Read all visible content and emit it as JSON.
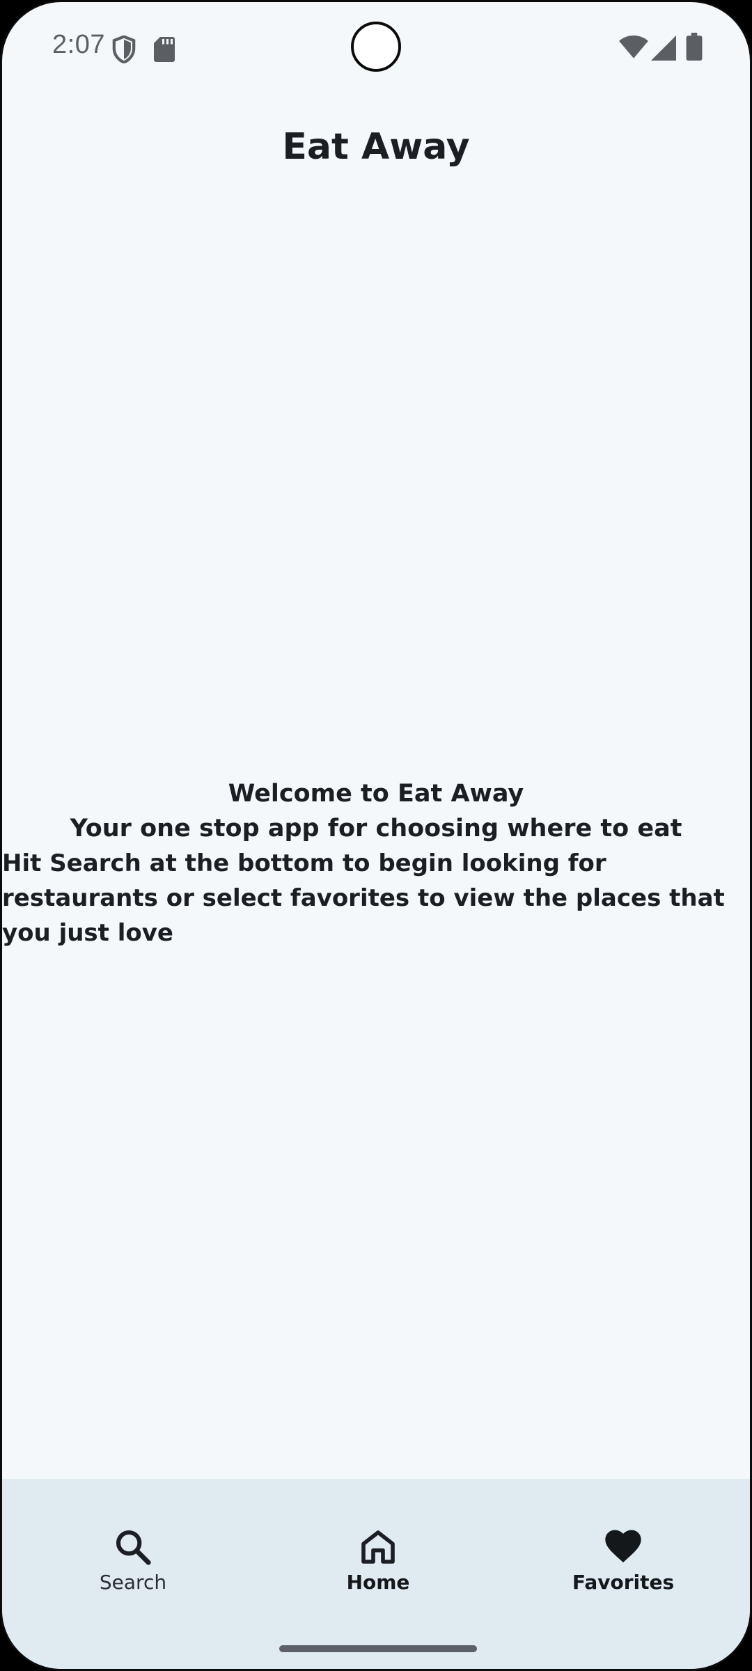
{
  "status_bar": {
    "time": "2:07",
    "icons": [
      "shield-icon",
      "sd-card-icon",
      "wifi-icon",
      "cell-signal-icon",
      "battery-icon"
    ]
  },
  "app": {
    "title": "Eat Away"
  },
  "welcome": {
    "line1": "Welcome to Eat Away",
    "line2": "Your one stop app for choosing where to eat",
    "line3": "Hit Search at the bottom to begin looking for restaurants or select favorites to view the places that you just love"
  },
  "bottom_nav": {
    "items": [
      {
        "label": "Search",
        "icon": "search-icon"
      },
      {
        "label": "Home",
        "icon": "home-icon"
      },
      {
        "label": "Favorites",
        "icon": "heart-icon"
      }
    ]
  },
  "colors": {
    "background": "#f4f8fb",
    "nav_background": "#e0ebf1",
    "text": "#1b1f23"
  }
}
